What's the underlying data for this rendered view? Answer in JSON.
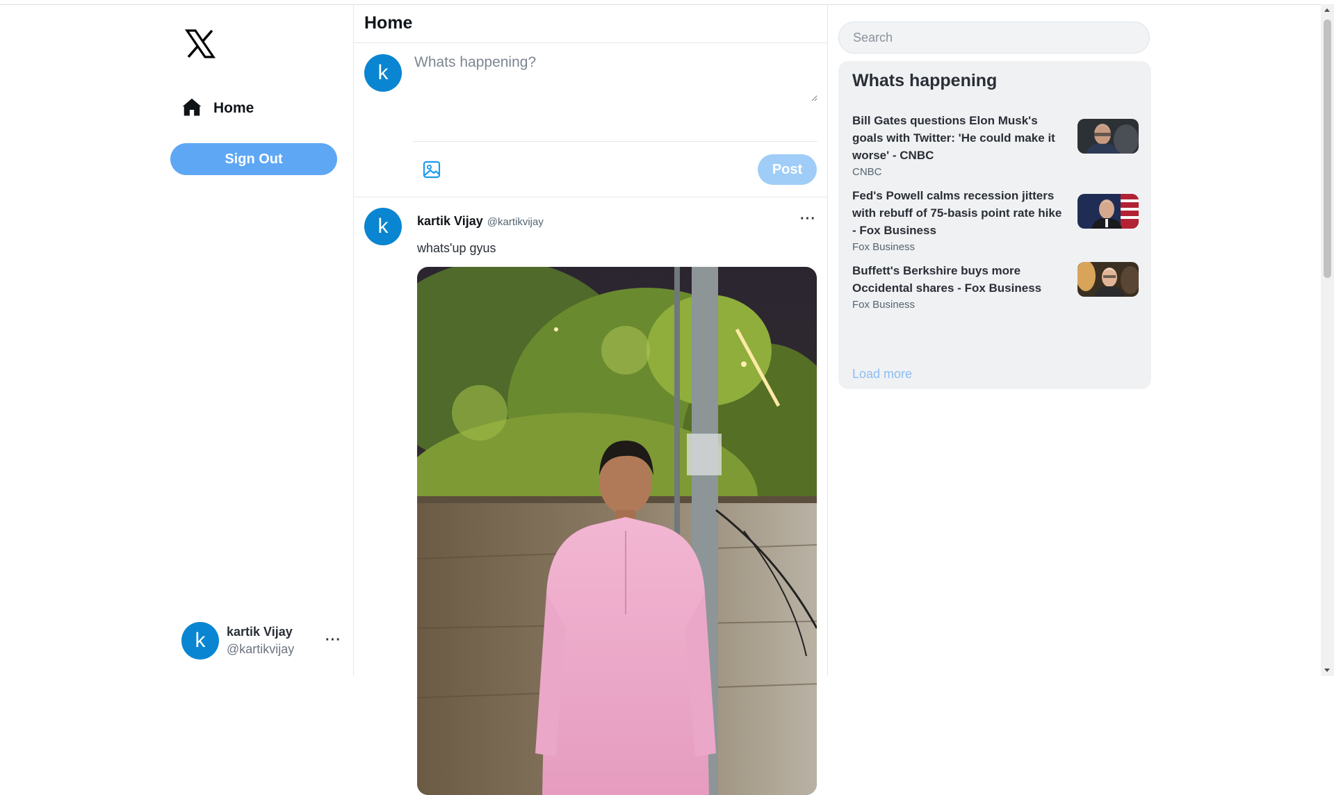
{
  "sidebar": {
    "logo_icon": "x-logo-icon",
    "nav_items": [
      {
        "label": "Home",
        "icon": "home-icon"
      }
    ],
    "sign_out_label": "Sign Out",
    "account": {
      "avatar_letter": "k",
      "name": "kartik Vijay",
      "handle": "@kartikvijay",
      "more": "···"
    }
  },
  "main": {
    "title": "Home",
    "composer": {
      "avatar_letter": "k",
      "placeholder": "Whats happening?",
      "media_icon": "image-icon",
      "post_label": "Post"
    },
    "tweet": {
      "avatar_letter": "k",
      "name": "kartik Vijay",
      "handle": "@kartikvijay",
      "more": "···",
      "text": "whats'up gyus",
      "image": "photo of a man in a pink kurta standing in front of a wall and trees at night"
    }
  },
  "right": {
    "search_placeholder": "Search",
    "trends_title": "Whats happening",
    "trends": [
      {
        "title": "Bill Gates questions Elon Musk's goals with Twitter: 'He could make it worse' - CNBC",
        "source": "CNBC"
      },
      {
        "title": "Fed's Powell calms recession jitters with rebuff of 75-basis point rate hike - Fox Business",
        "source": "Fox Business"
      },
      {
        "title": "Buffett's Berkshire buys more Occidental shares - Fox Business",
        "source": "Fox Business"
      }
    ],
    "load_more": "Load more"
  },
  "colors": {
    "accent": "#1d9bf0",
    "avatar": "#0a85d1",
    "sign_out": "#5ea7f5",
    "post_disabled": "#9fcdf8"
  }
}
